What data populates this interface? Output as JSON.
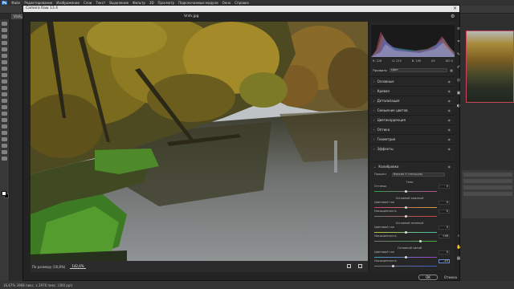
{
  "ps": {
    "logo": "Ps",
    "menu": [
      "Файл",
      "Редактирование",
      "Изображение",
      "Слои",
      "Текст",
      "Выделение",
      "Фильтр",
      "3D",
      "Просмотр",
      "Подключаемые модули",
      "Окно",
      "Справка"
    ],
    "doc_tab": "Vrsh.jpg @ 16,7% (RGB/8*)",
    "status": "16,67%    3968 пикс. x 2976 пикс. (300 ppi)"
  },
  "camera_raw": {
    "title": "Camera Raw 13.4",
    "filename": "Vrsh.jpg",
    "zoom_fit_label": "По размеру (16,8%)",
    "zoom_value": "142,6%",
    "histogram_readout": {
      "r": "R: 228",
      "g": "G: 215",
      "b": "B: 190",
      "f": "f/0",
      "iso": "ISO 0"
    },
    "profile_label": "Профиль",
    "profile_value": "Цвет",
    "sections": [
      {
        "label": "Основные"
      },
      {
        "label": "Кривая"
      },
      {
        "label": "Детализация"
      },
      {
        "label": "Смешение цветов"
      },
      {
        "label": "Цветокоррекция"
      },
      {
        "label": "Оптика"
      },
      {
        "label": "Геометрия"
      },
      {
        "label": "Эффекты"
      },
      {
        "label": "Калибровка"
      }
    ],
    "calibration": {
      "process_label": "Процесс",
      "process_value": "Версия 5 (текущая)",
      "shadows_heading": "Тени",
      "tint_label": "Оттенок",
      "tint_value": "0",
      "red_heading": "Основной красный",
      "red_hue_label": "Цветовой тон",
      "red_hue_value": "0",
      "red_sat_label": "Насыщенность",
      "red_sat_value": "0",
      "green_heading": "Основной зеленый",
      "green_hue_label": "Цветовой тон",
      "green_hue_value": "0",
      "green_sat_label": "Насыщенность",
      "green_sat_value": "+46",
      "blue_heading": "Основной синий",
      "blue_hue_label": "Цветовой тон",
      "blue_hue_value": "0",
      "blue_sat_label": "Насыщенность",
      "blue_sat_value": "-43"
    },
    "ok_label": "OK",
    "cancel_label": "Отмена"
  },
  "colors": {
    "accent": "#2d6bb5",
    "highlight": "#c8455a"
  }
}
